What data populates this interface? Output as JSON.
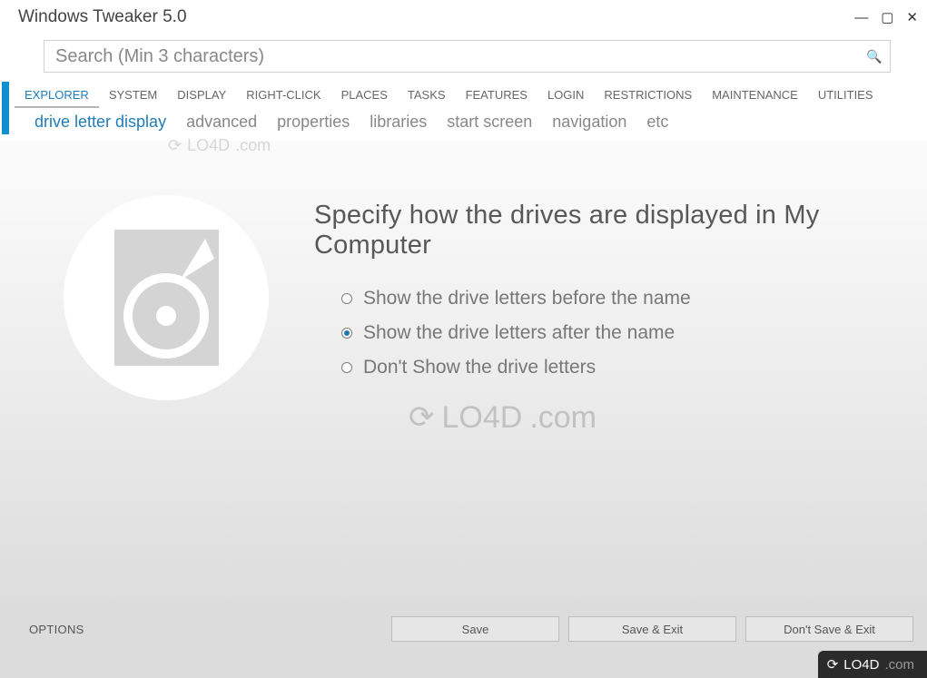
{
  "window": {
    "title": "Windows Tweaker 5.0"
  },
  "search": {
    "placeholder": "Search (Min 3 characters)"
  },
  "main_tabs": [
    "EXPLORER",
    "SYSTEM",
    "DISPLAY",
    "RIGHT-CLICK",
    "PLACES",
    "TASKS",
    "FEATURES",
    "LOGIN",
    "RESTRICTIONS",
    "MAINTENANCE",
    "UTILITIES"
  ],
  "active_main_tab": "EXPLORER",
  "sub_tabs": [
    "drive letter display",
    "advanced",
    "properties",
    "libraries",
    "start screen",
    "navigation",
    "etc"
  ],
  "active_sub_tab": "drive letter display",
  "content": {
    "heading": "Specify how the drives are displayed in My Computer",
    "options": [
      "Show the drive letters before the name",
      "Show the drive letters after the name",
      "Don't Show the drive letters"
    ],
    "selected_option_index": 1
  },
  "footer": {
    "options_label": "OPTIONS",
    "buttons": [
      "Save",
      "Save & Exit",
      "Don't Save & Exit"
    ]
  },
  "badge": {
    "text_a": "LO4D",
    "text_b": ".com"
  },
  "watermark": {
    "a": "LO4D",
    "b": ".com"
  }
}
